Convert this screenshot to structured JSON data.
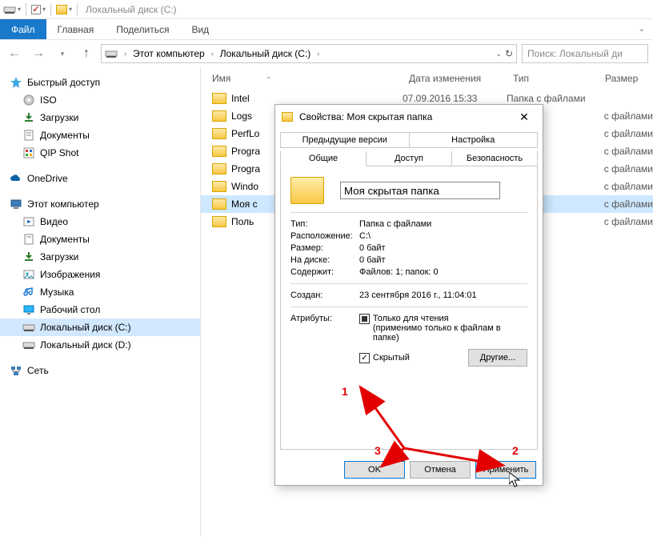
{
  "window_title": "Локальный диск (C:)",
  "ribbon": {
    "file": "Файл",
    "tabs": [
      "Главная",
      "Поделиться",
      "Вид"
    ]
  },
  "address": {
    "root": "Этот компьютер",
    "drive": "Локальный диск (C:)"
  },
  "search_placeholder": "Поиск: Локальный ди",
  "sidebar": {
    "quick": "Быстрый доступ",
    "quick_items": [
      "ISO",
      "Загрузки",
      "Документы",
      "QIP Shot"
    ],
    "onedrive": "OneDrive",
    "thispc": "Этот компьютер",
    "pc_items": [
      "Видео",
      "Документы",
      "Загрузки",
      "Изображения",
      "Музыка",
      "Рабочий стол",
      "Локальный диск (C:)",
      "Локальный диск (D:)"
    ],
    "network": "Сеть"
  },
  "columns": {
    "name": "Имя",
    "date": "Дата изменения",
    "type": "Тип",
    "size": "Размер"
  },
  "rows": [
    {
      "name": "Intel",
      "date": "07.09.2016 15:33",
      "type": "Папка с файлами"
    },
    {
      "name": "Logs",
      "date": "",
      "type": "с файлами"
    },
    {
      "name": "PerfLo",
      "date": "",
      "type": "с файлами"
    },
    {
      "name": "Progra",
      "date": "",
      "type": "с файлами"
    },
    {
      "name": "Progra",
      "date": "",
      "type": "с файлами"
    },
    {
      "name": "Windo",
      "date": "",
      "type": "с файлами"
    },
    {
      "name": "Моя с",
      "date": "",
      "type": "с файлами",
      "selected": true
    },
    {
      "name": "Поль",
      "date": "",
      "type": "с файлами"
    }
  ],
  "dialog": {
    "title": "Свойства: Моя скрытая папка",
    "tabs_top": [
      "Предыдущие версии",
      "Настройка"
    ],
    "tabs_bottom": [
      "Общие",
      "Доступ",
      "Безопасность"
    ],
    "name_value": "Моя скрытая папка",
    "labels": {
      "type": "Тип:",
      "type_value": "Папка с файлами",
      "location": "Расположение:",
      "location_value": "C:\\",
      "size": "Размер:",
      "size_value": "0 байт",
      "ondisk": "На диске:",
      "ondisk_value": "0 байт",
      "contains": "Содержит:",
      "contains_value": "Файлов: 1; папок: 0",
      "created": "Создан:",
      "created_value": "23 сентября 2016 г., 11:04:01",
      "attrs": "Атрибуты:",
      "readonly": "Только для чтения",
      "readonly_sub": "(применимо только к файлам в папке)",
      "hidden": "Скрытый",
      "other_btn": "Другие..."
    },
    "buttons": {
      "ok": "OK",
      "cancel": "Отмена",
      "apply": "Применить"
    }
  },
  "annotations": {
    "n1": "1",
    "n2": "2",
    "n3": "3"
  }
}
